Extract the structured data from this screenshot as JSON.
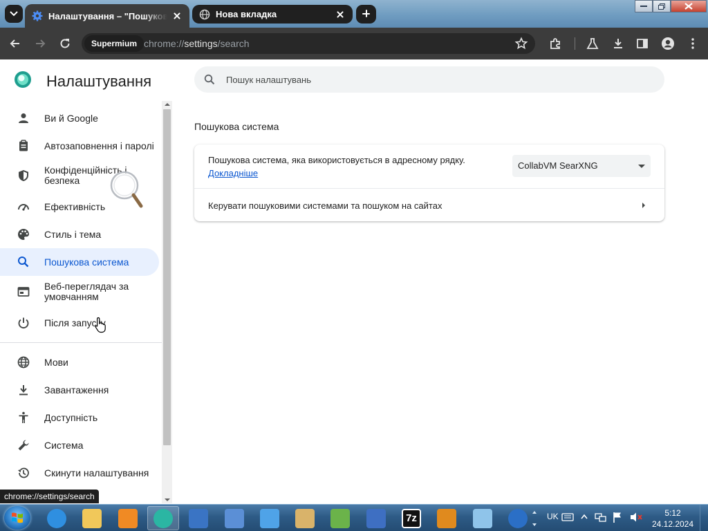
{
  "browser": {
    "tabs": [
      {
        "title": "Налаштування – \"Пошукова система\"",
        "active": true
      },
      {
        "title": "Нова вкладка",
        "active": false
      }
    ],
    "omnibox": {
      "chip_label": "Supermium",
      "url_prefix": "chrome://",
      "url_host": "settings",
      "url_path": "/search"
    },
    "status_url": "chrome://settings/search"
  },
  "settings": {
    "title": "Налаштування",
    "search_placeholder": "Пошук налаштувань",
    "nav": [
      {
        "label": "Ви й Google",
        "icon": "person-icon"
      },
      {
        "label": "Автозаповнення і паролі",
        "icon": "clipboard-icon"
      },
      {
        "label": "Конфіденційність і безпека",
        "icon": "shield-icon"
      },
      {
        "label": "Ефективність",
        "icon": "speedometer-icon"
      },
      {
        "label": "Стиль і тема",
        "icon": "palette-icon"
      },
      {
        "label": "Пошукова система",
        "icon": "search-icon",
        "selected": true
      },
      {
        "label": "Веб-переглядач за умовчанням",
        "icon": "browser-window-icon"
      },
      {
        "label": "Після запуску",
        "icon": "power-icon"
      },
      {
        "label": "Мови",
        "icon": "globe-icon"
      },
      {
        "label": "Завантаження",
        "icon": "download-icon"
      },
      {
        "label": "Доступність",
        "icon": "accessibility-icon"
      },
      {
        "label": "Система",
        "icon": "wrench-icon"
      },
      {
        "label": "Скинути налаштування",
        "icon": "history-icon"
      }
    ],
    "section": {
      "title": "Пошукова система",
      "engine_row_label": "Пошукова система, яка використовується в адресному рядку.",
      "learn_more": "Докладніше",
      "selected_engine": "CollabVM SearXNG",
      "manage_label": "Керувати пошуковими системами та пошуком на сайтах"
    }
  },
  "taskbar": {
    "language": "UK",
    "time": "5:12",
    "date": "24.12.2024",
    "apps": [
      {
        "icon": "internet-explorer-icon",
        "color": "#2f8fe0"
      },
      {
        "icon": "folder-icon",
        "color": "#f1c85a"
      },
      {
        "icon": "media-player-icon",
        "color": "#f08a24"
      },
      {
        "icon": "supermium-icon",
        "color": "#2bb6a3",
        "open": true
      },
      {
        "icon": "remote-desktop-icon",
        "color": "#3a74c4"
      },
      {
        "icon": "network-computer-icon",
        "color": "#5b8fd6"
      },
      {
        "icon": "paper-plane-icon",
        "color": "#4fa3e8"
      },
      {
        "icon": "paint-palette-icon",
        "color": "#d9b36a"
      },
      {
        "icon": "notepad-icon",
        "color": "#6bb34a"
      },
      {
        "icon": "infinity-icon",
        "color": "#3e6fc2"
      },
      {
        "icon": "seven-zip-icon",
        "color": "#111111",
        "text": "7z"
      },
      {
        "icon": "magnifier-app-icon",
        "color": "#e08a1e"
      },
      {
        "icon": "document-icon",
        "color": "#8fc4ea"
      },
      {
        "icon": "help-icon",
        "color": "#2b6fc6"
      }
    ]
  }
}
